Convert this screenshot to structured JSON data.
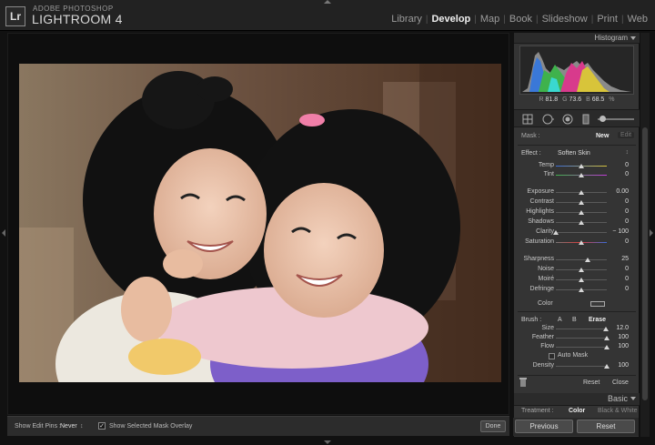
{
  "app": {
    "brand_small": "ADOBE PHOTOSHOP",
    "brand_big": "LIGHTROOM 4",
    "logo": "Lr"
  },
  "modules": [
    {
      "label": "Library",
      "active": false
    },
    {
      "label": "Develop",
      "active": true
    },
    {
      "label": "Map",
      "active": false
    },
    {
      "label": "Book",
      "active": false
    },
    {
      "label": "Slideshow",
      "active": false
    },
    {
      "label": "Print",
      "active": false
    },
    {
      "label": "Web",
      "active": false
    }
  ],
  "histogram": {
    "title": "Histogram",
    "r_label": "R",
    "r_value": "81.8",
    "g_label": "G",
    "g_value": "73.6",
    "b_label": "B",
    "b_value": "68.5",
    "unit": "%"
  },
  "mask": {
    "label": "Mask :",
    "new": "New",
    "edit": "Edit"
  },
  "effect": {
    "label": "Effect :",
    "value": "Soften Skin",
    "chev": "↕"
  },
  "sliders": [
    {
      "label": "Temp",
      "value": "0",
      "pos": 0.5,
      "track": "temp"
    },
    {
      "label": "Tint",
      "value": "0",
      "pos": 0.5,
      "track": "tint"
    },
    {
      "label": "Exposure",
      "value": "0.00",
      "pos": 0.5,
      "track": "plain"
    },
    {
      "label": "Contrast",
      "value": "0",
      "pos": 0.5,
      "track": "plain"
    },
    {
      "label": "Highlights",
      "value": "0",
      "pos": 0.5,
      "track": "plain"
    },
    {
      "label": "Shadows",
      "value": "0",
      "pos": 0.5,
      "track": "plain"
    },
    {
      "label": "Clarity",
      "value": "− 100",
      "pos": 0.0,
      "track": "plain"
    },
    {
      "label": "Saturation",
      "value": "0",
      "pos": 0.5,
      "track": "sat"
    },
    {
      "label": "Sharpness",
      "value": "25",
      "pos": 0.62,
      "track": "plain"
    },
    {
      "label": "Noise",
      "value": "0",
      "pos": 0.5,
      "track": "plain"
    },
    {
      "label": "Moiré",
      "value": "0",
      "pos": 0.5,
      "track": "plain"
    },
    {
      "label": "Defringe",
      "value": "0",
      "pos": 0.5,
      "track": "plain"
    }
  ],
  "color": {
    "label": "Color"
  },
  "brush": {
    "label": "Brush :",
    "a": "A",
    "b": "B",
    "erase": "Erase"
  },
  "brush_sliders": [
    {
      "label": "Size",
      "value": "12.0",
      "pos": 0.98
    },
    {
      "label": "Feather",
      "value": "100",
      "pos": 1.0
    },
    {
      "label": "Flow",
      "value": "100",
      "pos": 1.0
    }
  ],
  "auto_mask": {
    "label": "Auto Mask"
  },
  "density": {
    "label": "Density",
    "value": "100",
    "pos": 1.0
  },
  "panel_buttons": {
    "reset": "Reset",
    "close": "Close"
  },
  "basic": {
    "title": "Basic",
    "treatment_label": "Treatment :",
    "treatment_color": "Color",
    "treatment_bw": "Black & White"
  },
  "bottom": {
    "previous": "Previous",
    "reset": "Reset"
  },
  "toolbar": {
    "edit_pins_label": "Show Edit Pins :",
    "edit_pins_value": "Never",
    "edit_pins_chev": "↕",
    "overlay_label": "Show Selected Mask Overlay",
    "overlay_checked": "✓",
    "done": "Done"
  },
  "colors": {
    "accent": "#f0f0f0",
    "panel": "#343434",
    "topbar": "#222222"
  }
}
